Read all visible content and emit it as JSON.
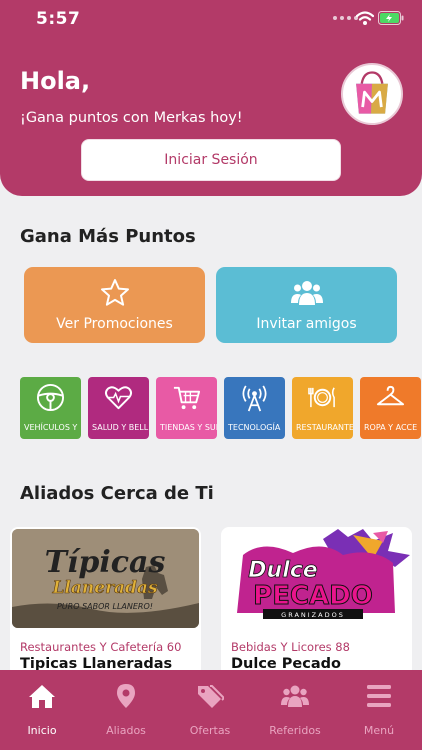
{
  "status_bar": {
    "time": "5:57"
  },
  "header": {
    "greeting": "Hola,",
    "subtitle": "¡Gana puntos con Merkas hoy!",
    "login_label": "Iniciar Sesión"
  },
  "earn_section": {
    "title": "Gana Más Puntos",
    "cards": [
      {
        "label": "Ver Promociones",
        "icon": "star-icon",
        "color": "#eb9853"
      },
      {
        "label": "Invitar amigos",
        "icon": "users-icon",
        "color": "#5bbdd4"
      }
    ]
  },
  "categories": [
    {
      "label": "VEHÍCULOS Y",
      "icon": "steering-wheel-icon",
      "color": "#5cab45"
    },
    {
      "label": "SALUD Y BELLE",
      "icon": "heart-pulse-icon",
      "color": "#b02a7f"
    },
    {
      "label": "TIENDAS Y SUI",
      "icon": "cart-icon",
      "color": "#e85aa5"
    },
    {
      "label": "TECNOLOGÍA",
      "icon": "antenna-icon",
      "color": "#3876bd"
    },
    {
      "label": "RESTAURANTE",
      "icon": "dish-icon",
      "color": "#f0a72c"
    },
    {
      "label": "ROPA Y ACCE",
      "icon": "hanger-icon",
      "color": "#ef7a2a"
    }
  ],
  "allies_section": {
    "title": "Aliados Cerca de Ti",
    "items": [
      {
        "category": "Restaurantes Y Cafetería 60",
        "name": "Tipicas Llaneradas",
        "logo_line1": "Típicas",
        "logo_line2": "Llaneradas",
        "logo_tag": "PURO SABOR LLANERO!"
      },
      {
        "category": "Bebidas Y Licores 88",
        "name": "Dulce Pecado",
        "logo_line1": "Dulce",
        "logo_line2": "PECADO",
        "logo_tag": "GRANIZADOS"
      }
    ]
  },
  "bottom_nav": [
    {
      "label": "Inicio",
      "icon": "home-icon",
      "active": true
    },
    {
      "label": "Aliados",
      "icon": "map-pin-icon",
      "active": false
    },
    {
      "label": "Ofertas",
      "icon": "tags-icon",
      "active": false
    },
    {
      "label": "Referidos",
      "icon": "users-icon",
      "active": false
    },
    {
      "label": "Menú",
      "icon": "menu-icon",
      "active": false
    }
  ],
  "colors": {
    "brand": "#b33a68",
    "background": "#efeff1"
  }
}
